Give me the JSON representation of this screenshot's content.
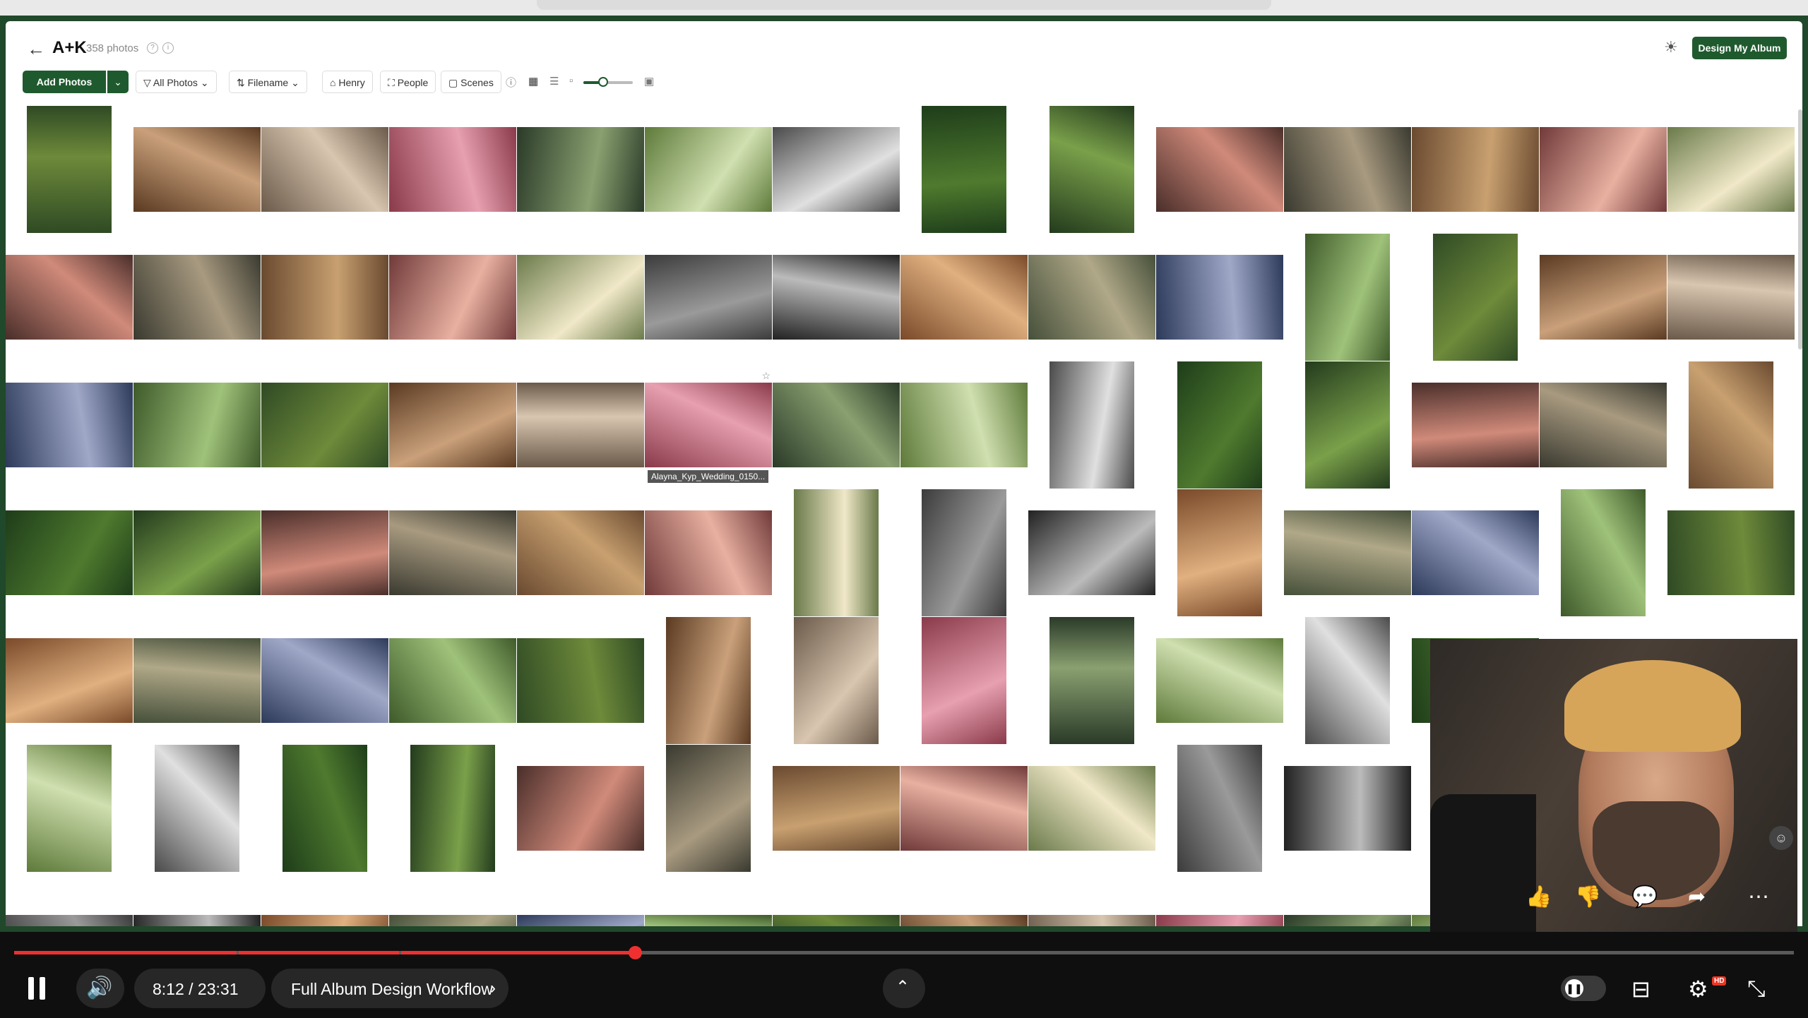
{
  "header": {
    "title": "A+K",
    "photo_count": "358 photos",
    "design_button": "Design My Album"
  },
  "toolbar": {
    "add_photos": "Add Photos",
    "all_photos": "All Photos",
    "filename": "Filename",
    "henry": "Henry",
    "people": "People",
    "scenes": "Scenes",
    "zoom_level": 0.4
  },
  "grid": {
    "hover_filename": "Alayna_Kyp_Wedding_0150..."
  },
  "colors": {
    "brand_green": "#1f5a2e",
    "frame_green": "#20482a",
    "progress_red": "#f03030"
  },
  "video": {
    "time": "8:12 / 23:31",
    "chapter": "Full Album Design Workflow",
    "progress": 0.349
  }
}
